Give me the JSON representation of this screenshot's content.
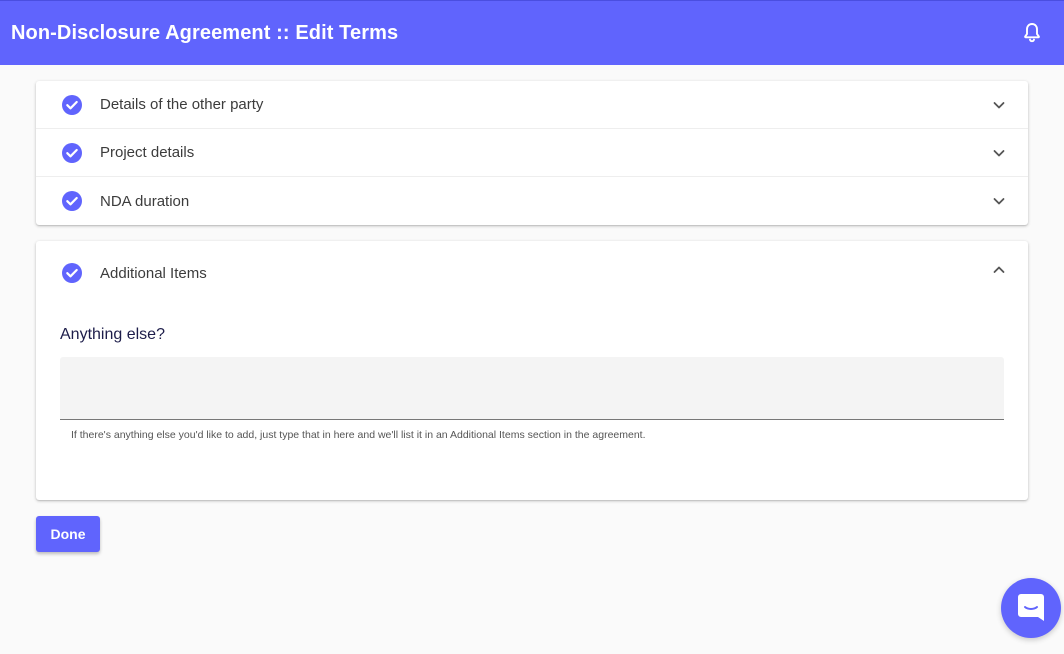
{
  "header": {
    "title": "Non-Disclosure Agreement :: Edit Terms",
    "notification_icon": "bell-icon"
  },
  "colors": {
    "primary": "#6064fd",
    "check": "#6064fd"
  },
  "sections": [
    {
      "label": "Details of the other party",
      "completed": true,
      "expanded": false
    },
    {
      "label": "Project details",
      "completed": true,
      "expanded": false
    },
    {
      "label": "NDA duration",
      "completed": true,
      "expanded": false
    }
  ],
  "additional": {
    "label": "Additional Items",
    "completed": true,
    "expanded": true,
    "question": "Anything else?",
    "value": "",
    "hint": "If there's anything else you'd like to add, just type that in here and we'll list it in an Additional Items section in the agreement."
  },
  "actions": {
    "done_label": "Done"
  },
  "chat": {
    "icon": "chat-icon"
  }
}
